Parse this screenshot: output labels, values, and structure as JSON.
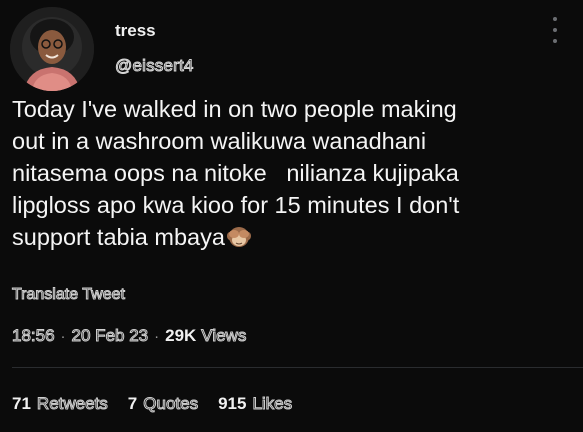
{
  "author": {
    "display_name": "tress",
    "handle": "@eissert4",
    "avatar_icon": "profile-photo"
  },
  "menu": {
    "icon": "more-vertical-icon"
  },
  "tweet": {
    "text": "Today I've walked in on two people making\nout in a washroom walikuwa wanadhani\nnitasema oops na nitoke   nilianza kujipaka\nlipgloss apo kwa kioo for 15 minutes I don't\nsupport tabia mbaya",
    "emoji": "see-no-evil-monkey-emoji"
  },
  "translate": {
    "label": "Translate Tweet"
  },
  "meta": {
    "time": "18:56",
    "separator": "·",
    "date": "20 Feb 23",
    "views_count": "29K",
    "views_label": "Views"
  },
  "stats": {
    "retweets_count": "71",
    "retweets_label": "Retweets",
    "quotes_count": "7",
    "quotes_label": "Quotes",
    "likes_count": "915",
    "likes_label": "Likes"
  },
  "colors": {
    "background": "#0b0b0b",
    "text": "#f5f5f5",
    "muted": "#6b6e72",
    "divider": "#2a2c2f"
  }
}
